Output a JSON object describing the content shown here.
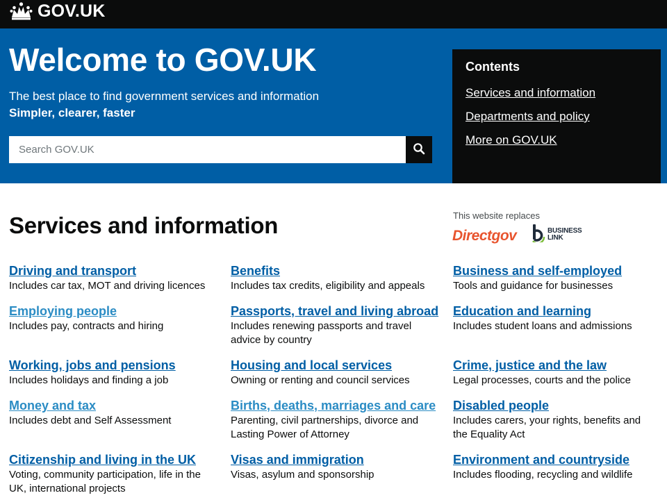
{
  "header": {
    "logo_text": "GOV.UK"
  },
  "hero": {
    "title": "Welcome to GOV.UK",
    "tagline": "The best place to find government services and information",
    "strapline": "Simpler, clearer, faster",
    "search_placeholder": "Search GOV.UK"
  },
  "contents": {
    "title": "Contents",
    "links": [
      "Services and information",
      "Departments and policy",
      "More on GOV.UK"
    ]
  },
  "services": {
    "title": "Services and information",
    "replaces_label": "This website replaces",
    "directgov_logo": "Directgov",
    "businesslink_logo": [
      "BUSINESS",
      "LINK"
    ],
    "columns": [
      [
        {
          "title": "Driving and transport",
          "desc": "Includes car tax, MOT and driving licences"
        },
        {
          "title": "Employing people",
          "desc": "Includes pay, contracts and hiring"
        },
        {
          "title": "Working, jobs and pensions",
          "desc": "Includes holidays and finding a job"
        },
        {
          "title": "Money and tax",
          "desc": "Includes debt and Self Assessment"
        },
        {
          "title": "Citizenship and living in the UK",
          "desc": "Voting, community participation, life in the UK, international projects"
        }
      ],
      [
        {
          "title": "Benefits",
          "desc": "Includes tax credits, eligibility and appeals"
        },
        {
          "title": "Passports, travel and living abroad",
          "desc": "Includes renewing passports and travel advice by country"
        },
        {
          "title": "Housing and local services",
          "desc": "Owning or renting and council services"
        },
        {
          "title": "Births, deaths, marriages and care",
          "desc": "Parenting, civil partnerships, divorce and Lasting Power of Attorney"
        },
        {
          "title": "Visas and immigration",
          "desc": "Visas, asylum and sponsorship"
        }
      ],
      [
        {
          "title": "Business and self-employed",
          "desc": "Tools and guidance for businesses"
        },
        {
          "title": "Education and learning",
          "desc": "Includes student loans and admissions"
        },
        {
          "title": "Crime, justice and the law",
          "desc": "Legal processes, courts and the police"
        },
        {
          "title": "Disabled people",
          "desc": "Includes carers, your rights, benefits and the Equality Act"
        },
        {
          "title": "Environment and countryside",
          "desc": "Includes flooding, recycling and wildlife"
        }
      ]
    ]
  },
  "colors": {
    "header_bg": "#0b0c0c",
    "hero_bg": "#005ea5",
    "link": "#005ea5",
    "visited_link": "#2b8cc4",
    "directgov": "#e8542e"
  },
  "icons": {
    "logo": "crown-icon",
    "search": "search-icon"
  }
}
